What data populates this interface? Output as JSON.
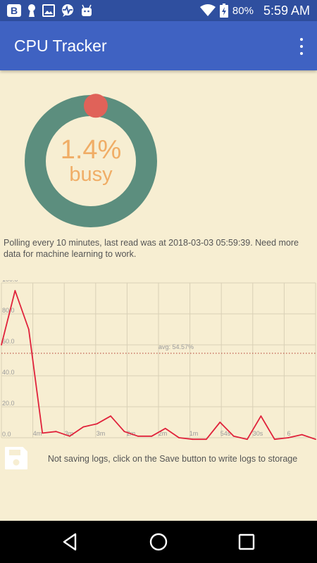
{
  "status_bar": {
    "battery": "80%",
    "time": "5:59 AM"
  },
  "app_bar": {
    "title": "CPU Tracker"
  },
  "gauge": {
    "value_text": "1.4%",
    "label": "busy",
    "value_fraction": 0.014,
    "ring_color": "#5c8e7e",
    "indicator_color": "#e06259",
    "text_color": "#f0ad66"
  },
  "status_message": "Polling every 10 minutes, last read was at 2018-03-03 05:59:39. Need more data for machine learning to work.",
  "chart_data": {
    "type": "line",
    "y_tick_labels": [
      "100.0",
      "80.0",
      "60.0",
      "40.0",
      "20.0",
      "0.0"
    ],
    "x_tick_labels": [
      "4m",
      "3m",
      "3m",
      "2m",
      "2m",
      "1m",
      "54s",
      "30s",
      "6"
    ],
    "ylim": [
      0,
      100
    ],
    "average_label": "avg: 54.57%",
    "average": 54.57,
    "series_color": "#e0223b",
    "average_line_color": "#b33a2e",
    "grid": true,
    "values": [
      60,
      95,
      70,
      3,
      4,
      1,
      7,
      9,
      14,
      4,
      1,
      1,
      6,
      0,
      -1,
      -1,
      10,
      1,
      -1,
      14,
      -1,
      0,
      2,
      -1
    ]
  },
  "log_message": "Not saving logs, click on the Save button to write logs to storage",
  "icons": {
    "save": "floppy-disk-icon",
    "menu": "overflow-menu-icon",
    "back": "back-triangle-icon",
    "home": "home-circle-icon",
    "recents": "recents-square-icon"
  }
}
